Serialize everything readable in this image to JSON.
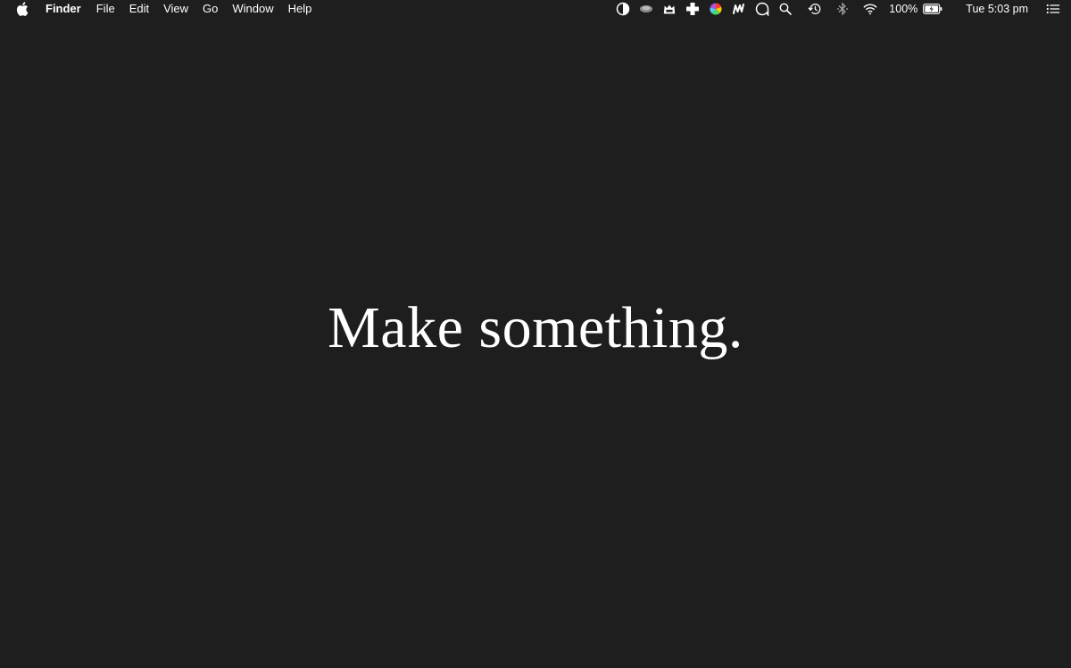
{
  "menubar": {
    "apple_icon": "apple-icon",
    "app_name": "Finder",
    "menus": [
      "File",
      "Edit",
      "View",
      "Go",
      "Window",
      "Help"
    ],
    "status_icons": [
      "half-circle-icon",
      "cloud-blob-icon",
      "cat-app-icon",
      "plus-cross-icon",
      "color-wheel-icon",
      "m-script-icon",
      "speech-bubble-icon",
      "search-icon",
      "time-machine-icon",
      "bluetooth-icon",
      "wifi-icon"
    ],
    "battery_percent": "100%",
    "clock": "Tue 5:03 pm",
    "notification_icon": "notification-center-icon"
  },
  "desktop": {
    "tagline": "Make something."
  },
  "colors": {
    "background": "#1e1e1e",
    "text": "#ffffff"
  }
}
